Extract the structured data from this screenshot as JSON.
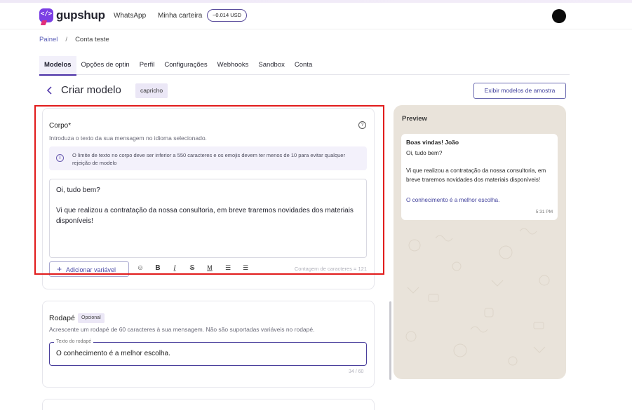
{
  "header": {
    "brand": "gupshup",
    "nav": [
      "WhatsApp",
      "Minha carteira"
    ],
    "wallet_balance": "−0.014 USD"
  },
  "breadcrumb": {
    "root": "Painel",
    "separator": "/",
    "current": "Conta teste"
  },
  "tabs": [
    {
      "label": "Modelos",
      "active": true
    },
    {
      "label": "Opções de optin"
    },
    {
      "label": "Perfil"
    },
    {
      "label": "Configurações"
    },
    {
      "label": "Webhooks"
    },
    {
      "label": "Sandbox"
    },
    {
      "label": "Conta"
    }
  ],
  "page": {
    "title": "Criar modelo",
    "template_name": "capricho",
    "sample_button": "Exibir modelos de amostra"
  },
  "body_section": {
    "label": "Corpo*",
    "help": "Introduza o texto da sua mensagem no idioma selecionado.",
    "help_icon": "?",
    "info_icon": "i",
    "info": "O limite de texto no corpo deve ser inferior a 550 caracteres e os emojis devem ter menos de 10 para evitar qualquer rejeição de modelo",
    "text": "Oi, tudo bem?\n\nVi que realizou a contratação da nossa consultoria, em breve traremos novidades dos materiais disponíveis!",
    "add_variable": "Adicionar variável",
    "char_count": "Contagem de caracteres = 121",
    "toolbar_icons": [
      "emoji-icon",
      "bold-icon",
      "italic-icon",
      "strikethrough-icon",
      "monospace-icon",
      "numbered-list-icon",
      "bullet-list-icon"
    ]
  },
  "footer_section": {
    "label": "Rodapé",
    "badge": "Opcional",
    "help": "Acrescente um rodapé de 60 caracteres à sua mensagem. Não são suportadas variáveis no rodapé.",
    "field_label": "Texto do rodapé",
    "value": "O conhecimento é a melhor escolha.",
    "count": "34 / 60"
  },
  "preview": {
    "title": "Preview",
    "header": "Boas vindas! João",
    "body": "Oi, tudo bem?\n\nVi que realizou a contratação da nossa consultoria, em breve traremos novidades dos materiais disponíveis!",
    "footer": "O conhecimento é a melhor escolha.",
    "time": "5:31 PM"
  },
  "colors": {
    "accent": "#4a2fa6",
    "highlight": "#e11b1b",
    "preview_bg": "#e9e3da"
  }
}
